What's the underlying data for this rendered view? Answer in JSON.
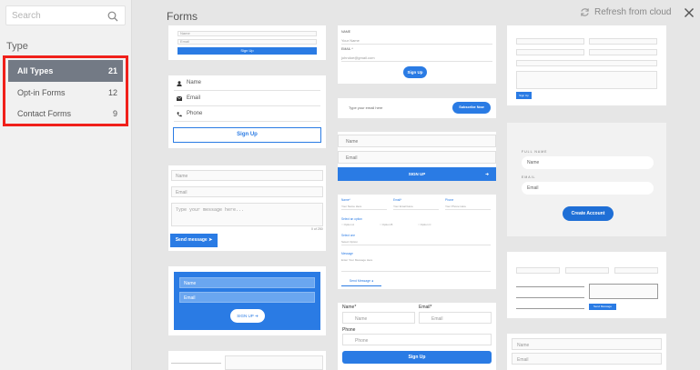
{
  "sidebar": {
    "search_placeholder": "Search",
    "type_heading": "Type",
    "types": [
      {
        "label": "All Types",
        "count": "21"
      },
      {
        "label": "Opt-in Forms",
        "count": "12"
      },
      {
        "label": "Contact Forms",
        "count": "9"
      }
    ]
  },
  "main": {
    "title": "Forms",
    "refresh_label": "Refresh from cloud"
  },
  "cards": {
    "c1": {
      "f1": "Name",
      "f2": "Email",
      "btn": "Sign Up"
    },
    "c2": {
      "name": "Name",
      "email": "Email",
      "phone": "Phone",
      "btn": "Sign Up"
    },
    "c3": {
      "name": "Name",
      "email": "Email",
      "message": "Type your message here...",
      "counter": "0 of 250",
      "btn": "Send message"
    },
    "c4": {
      "name": "Name",
      "email": "Email",
      "btn": "SIGN UP"
    },
    "c6": {
      "label1": "NAME",
      "f1": "Your Name",
      "label2": "EMAIL *",
      "f2": "johndoe@gmail.com",
      "btn": "Sign Up"
    },
    "c7": {
      "placeholder": "Type your email here",
      "btn": "Subscribe Now"
    },
    "c8": {
      "name": "Name",
      "email": "Email",
      "btn": "SIGN UP"
    },
    "c9": {
      "name": "Name*",
      "email": "Email*",
      "phone": "Phone",
      "name_ph": "Your Name Here",
      "email_ph": "Your Email Here",
      "phone_ph": "Your Phone Here",
      "options_label": "Select an option",
      "opt_a": "Option A",
      "opt_b": "Option B",
      "opt_c": "Option C",
      "select_label": "Select one",
      "select_ph": "Select Option",
      "message_label": "Message",
      "message_ph": "Enter Your Message Here",
      "btn": "Send Message"
    },
    "c10": {
      "name": "Name*",
      "email": "Email*",
      "name_ph": "Name",
      "email_ph": "Email",
      "phone": "Phone",
      "phone_ph": "Phone",
      "btn": "Sign Up"
    },
    "c11": {
      "name": "Name",
      "email": "Email",
      "btn": "Sign Up"
    },
    "c12": {
      "label1": "FULL NAME",
      "f1": "Name",
      "label2": "EMAIL",
      "f2": "Email",
      "btn": "Create Account"
    },
    "c13": {
      "btn": "Send Message"
    },
    "c14": {
      "f1": "Name",
      "f2": "Email"
    }
  },
  "colors": {
    "accent": "#2a7be4",
    "highlight": "#f0201a",
    "active_bg": "#737a85"
  }
}
